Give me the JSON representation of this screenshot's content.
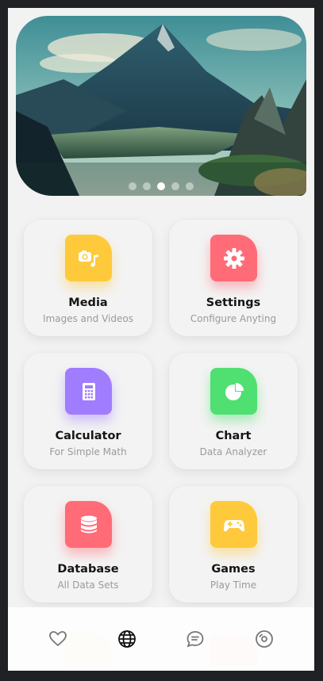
{
  "hero": {
    "slide_count": 5,
    "active_slide": 3
  },
  "cards": [
    {
      "title": "Media",
      "subtitle": "Images and Videos",
      "icon": "media-icon",
      "color": "#FFC93C"
    },
    {
      "title": "Settings",
      "subtitle": "Configure Anyting",
      "icon": "gear-icon",
      "color": "#FF6B76"
    },
    {
      "title": "Calculator",
      "subtitle": "For Simple Math",
      "icon": "calculator-icon",
      "color": "#A07CFF"
    },
    {
      "title": "Chart",
      "subtitle": "Data Analyzer",
      "icon": "pie-chart-icon",
      "color": "#4FE071"
    },
    {
      "title": "Database",
      "subtitle": "All Data Sets",
      "icon": "database-icon",
      "color": "#FF6B76"
    },
    {
      "title": "Games",
      "subtitle": "Play Time",
      "icon": "gamepad-icon",
      "color": "#FFC93C"
    }
  ],
  "nav": {
    "items": [
      {
        "icon": "heart-icon",
        "active": false
      },
      {
        "icon": "globe-icon",
        "active": true
      },
      {
        "icon": "chat-icon",
        "active": false
      },
      {
        "icon": "disc-icon",
        "active": false
      }
    ],
    "active_color": "#111111",
    "inactive_color": "#777777"
  }
}
